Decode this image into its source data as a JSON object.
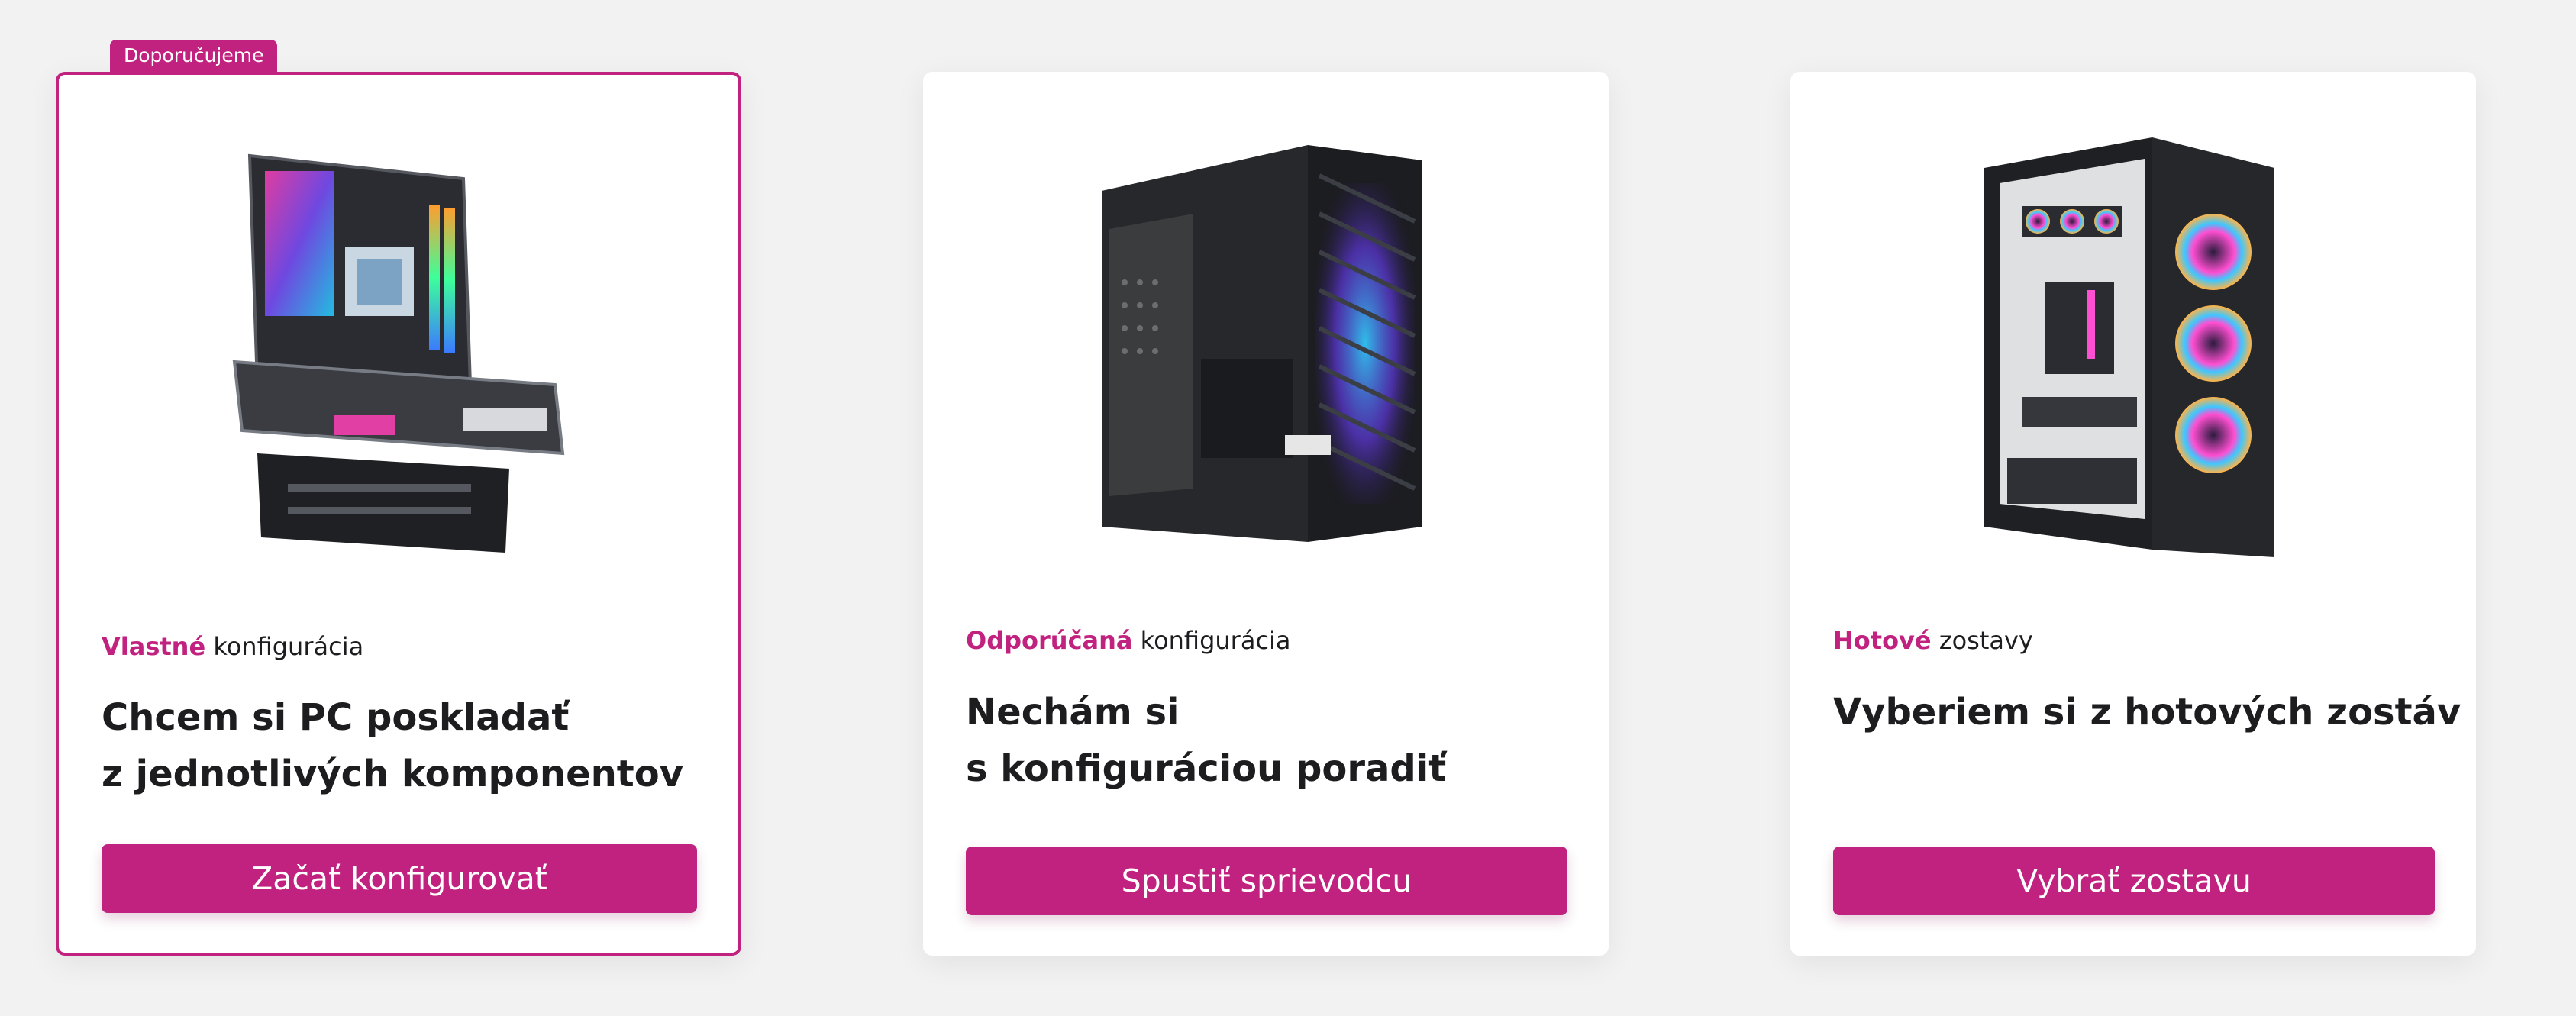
{
  "colors": {
    "accent": "#c2227f",
    "background": "#f2f2f3",
    "card": "#ffffff",
    "text": "#1d1d1f"
  },
  "cards": [
    {
      "badge": "Doporučujeme",
      "image": "motherboard-gpu-image",
      "subtitle_accent": "Vlastné",
      "subtitle_rest": " konfigurácia",
      "title_line1": "Chcem si PC poskladať",
      "title_line2": "z jednotlivých komponentov",
      "button": "Začať konfigurovať"
    },
    {
      "image": "pc-case-image",
      "subtitle_accent": "Odporúčaná",
      "subtitle_rest": " konfigurácia",
      "title_line1": "Nechám si",
      "title_line2": "s konfiguráciou poradiť",
      "button": "Spustiť sprievodcu"
    },
    {
      "image": "prebuilt-pc-image",
      "subtitle_accent": "Hotové",
      "subtitle_rest": " zostavy",
      "title_line1": "Vyberiem si z hotových zostáv",
      "button": "Vybrať zostavu"
    }
  ]
}
